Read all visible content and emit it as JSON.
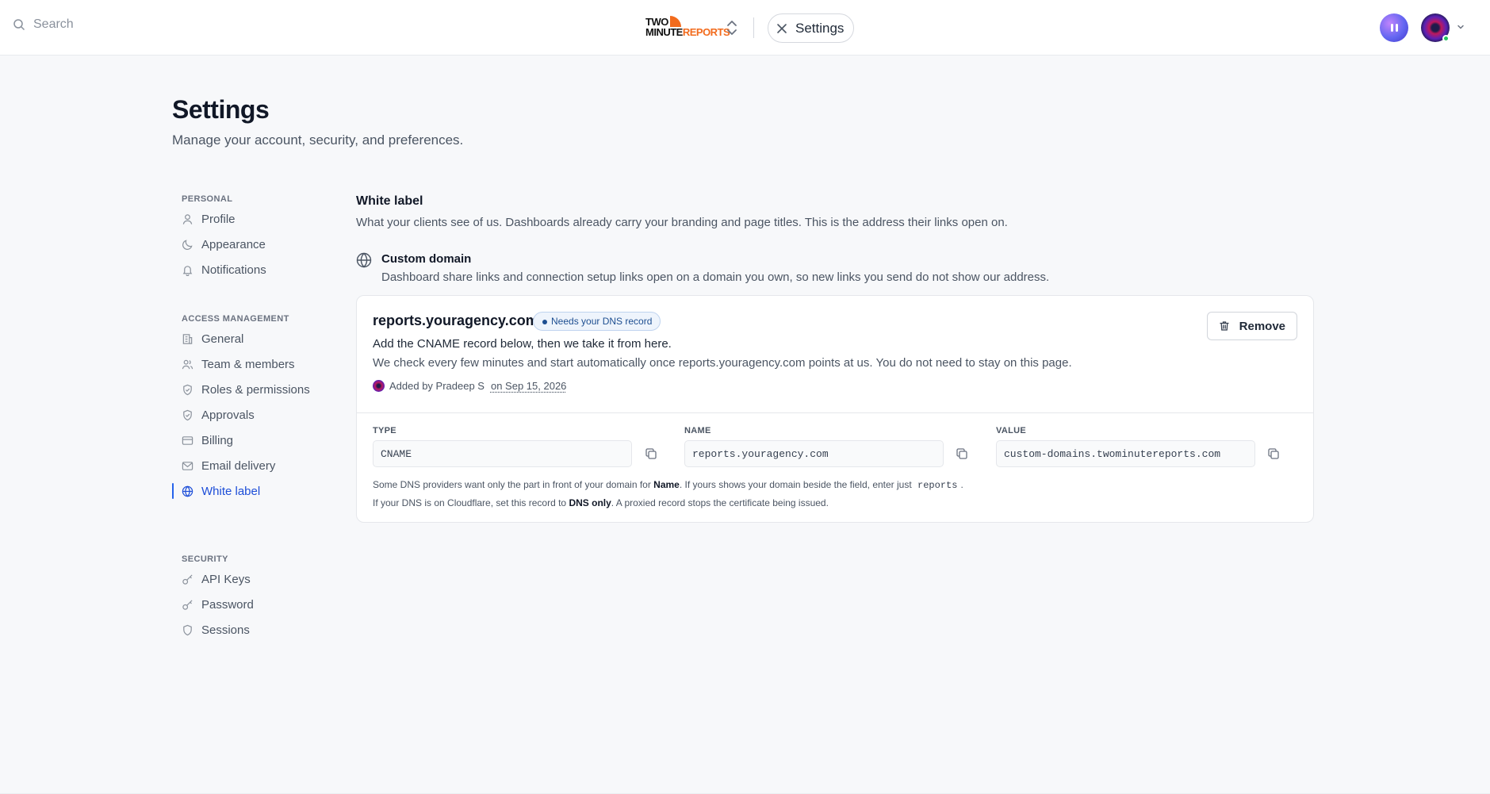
{
  "topbar": {
    "search_placeholder": "Search",
    "logo_line1": "TWO",
    "logo_line2a": "MINUTE",
    "logo_line2b": "REPORTS",
    "tab_label": "Settings"
  },
  "page": {
    "title": "Settings",
    "subtitle": "Manage your account, security, and preferences."
  },
  "sidebar": {
    "sections": [
      {
        "label": "PERSONAL",
        "items": [
          {
            "label": "Profile",
            "icon": "user-icon"
          },
          {
            "label": "Appearance",
            "icon": "moon-icon"
          },
          {
            "label": "Notifications",
            "icon": "bell-icon"
          }
        ]
      },
      {
        "label": "ACCESS MANAGEMENT",
        "items": [
          {
            "label": "General",
            "icon": "building-icon"
          },
          {
            "label": "Team & members",
            "icon": "users-icon"
          },
          {
            "label": "Roles & permissions",
            "icon": "shield-check-icon"
          },
          {
            "label": "Approvals",
            "icon": "shield-check-icon"
          },
          {
            "label": "Billing",
            "icon": "credit-card-icon"
          },
          {
            "label": "Email delivery",
            "icon": "mail-icon"
          },
          {
            "label": "White label",
            "icon": "globe-icon",
            "active": true
          }
        ]
      },
      {
        "label": "SECURITY",
        "items": [
          {
            "label": "API Keys",
            "icon": "key-icon"
          },
          {
            "label": "Password",
            "icon": "key-icon"
          },
          {
            "label": "Sessions",
            "icon": "shield-icon"
          }
        ]
      }
    ]
  },
  "main": {
    "title": "White label",
    "description": "What your clients see of us. Dashboards already carry your branding and page titles. This is the address their links open on.",
    "custom_domain": {
      "title": "Custom domain",
      "description": "Dashboard share links and connection setup links open on a domain you own, so new links you send do not show our address."
    },
    "card": {
      "domain": "reports.youragency.com",
      "status": "Needs your DNS record",
      "line1": "Add the CNAME record below, then we take it from here.",
      "line2": "We check every few minutes and start automatically once reports.youragency.com points at us. You do not need to stay on this page.",
      "added_by": "Added by Pradeep S",
      "added_on": "on Sep 15, 2026",
      "remove_label": "Remove",
      "fields": [
        {
          "label": "TYPE",
          "value": "CNAME"
        },
        {
          "label": "NAME",
          "value": "reports.youragency.com"
        },
        {
          "label": "VALUE",
          "value": "custom-domains.twominutereports.com"
        }
      ],
      "hint1_a": "Some DNS providers want only the part in front of your domain for ",
      "hint1_b": "Name",
      "hint1_c": ". If yours shows your domain beside the field, enter just ",
      "hint1_code": "reports",
      "hint1_d": ".",
      "hint2_a": "If your DNS is on Cloudflare, set this record to ",
      "hint2_b": "DNS only",
      "hint2_c": ". A proxied record stops the certificate being issued."
    }
  },
  "colors": {
    "accent": "#1d4ed8",
    "brand_orange": "#f26b1d",
    "badge_text": "#1e4f91"
  }
}
